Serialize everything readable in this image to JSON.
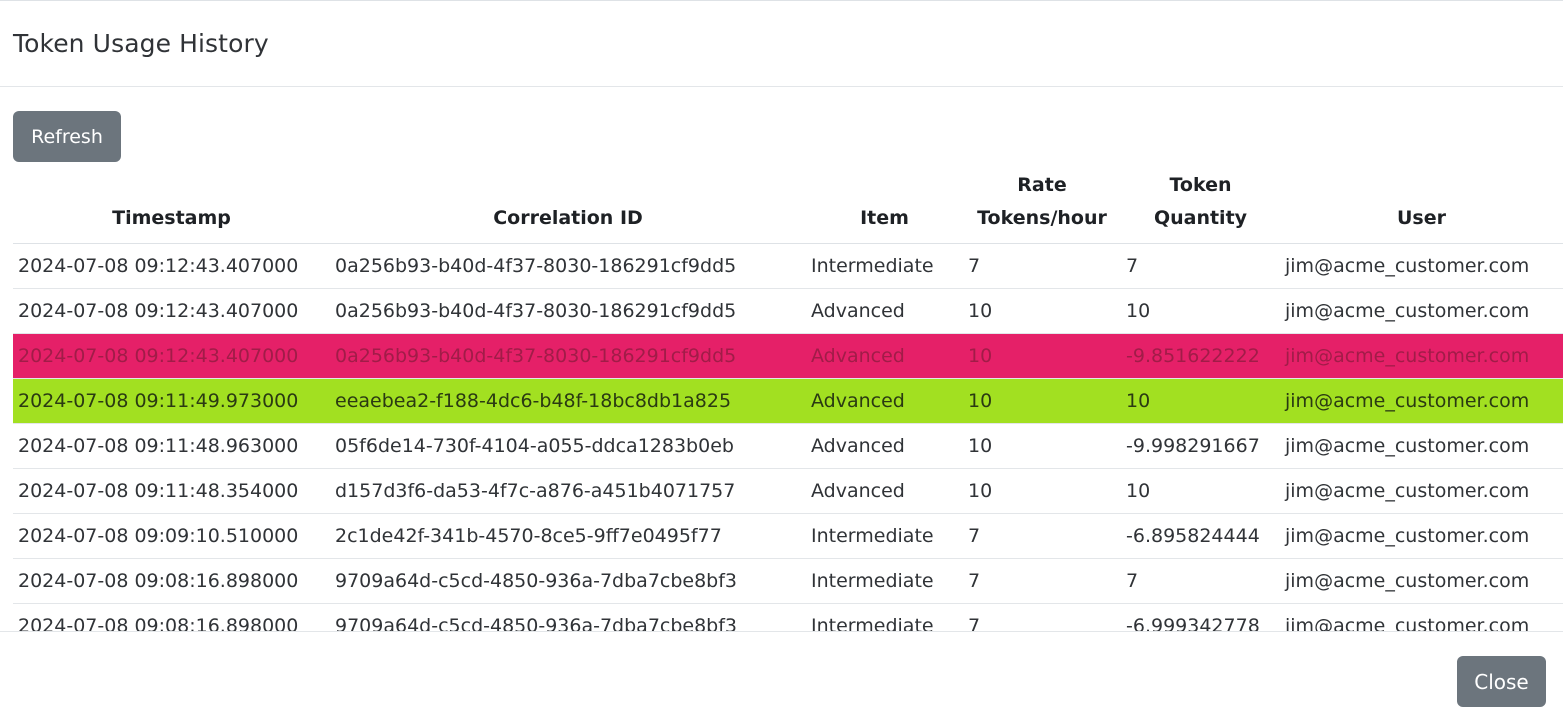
{
  "modal": {
    "title": "Token Usage History",
    "refresh_label": "Refresh",
    "close_label": "Close"
  },
  "table": {
    "headers": {
      "timestamp": "Timestamp",
      "correlation_id": "Correlation ID",
      "item": "Item",
      "rate_line1": "Rate",
      "rate_line2": "Tokens/hour",
      "qty_line1": "Token",
      "qty_line2": "Quantity",
      "user": "User"
    },
    "rows": [
      {
        "timestamp": "2024-07-08 09:12:43.407000",
        "correlation_id": "0a256b93-b40d-4f37-8030-186291cf9dd5",
        "item": "Intermediate",
        "rate": "7",
        "quantity": "7",
        "user": "jim@acme_customer.com",
        "status": "normal"
      },
      {
        "timestamp": "2024-07-08 09:12:43.407000",
        "correlation_id": "0a256b93-b40d-4f37-8030-186291cf9dd5",
        "item": "Advanced",
        "rate": "10",
        "quantity": "10",
        "user": "jim@acme_customer.com",
        "status": "normal"
      },
      {
        "timestamp": "2024-07-08 09:12:43.407000",
        "correlation_id": "0a256b93-b40d-4f37-8030-186291cf9dd5",
        "item": "Advanced",
        "rate": "10",
        "quantity": "-9.851622222",
        "user": "jim@acme_customer.com",
        "status": "danger"
      },
      {
        "timestamp": "2024-07-08 09:11:49.973000",
        "correlation_id": "eeaebea2-f188-4dc6-b48f-18bc8db1a825",
        "item": "Advanced",
        "rate": "10",
        "quantity": "10",
        "user": "jim@acme_customer.com",
        "status": "success"
      },
      {
        "timestamp": "2024-07-08 09:11:48.963000",
        "correlation_id": "05f6de14-730f-4104-a055-ddca1283b0eb",
        "item": "Advanced",
        "rate": "10",
        "quantity": "-9.998291667",
        "user": "jim@acme_customer.com",
        "status": "normal"
      },
      {
        "timestamp": "2024-07-08 09:11:48.354000",
        "correlation_id": "d157d3f6-da53-4f7c-a876-a451b4071757",
        "item": "Advanced",
        "rate": "10",
        "quantity": "10",
        "user": "jim@acme_customer.com",
        "status": "normal"
      },
      {
        "timestamp": "2024-07-08 09:09:10.510000",
        "correlation_id": "2c1de42f-341b-4570-8ce5-9ff7e0495f77",
        "item": "Intermediate",
        "rate": "7",
        "quantity": "-6.895824444",
        "user": "jim@acme_customer.com",
        "status": "normal"
      },
      {
        "timestamp": "2024-07-08 09:08:16.898000",
        "correlation_id": "9709a64d-c5cd-4850-936a-7dba7cbe8bf3",
        "item": "Intermediate",
        "rate": "7",
        "quantity": "7",
        "user": "jim@acme_customer.com",
        "status": "normal"
      },
      {
        "timestamp": "2024-07-08 09:08:16.898000",
        "correlation_id": "9709a64d-c5cd-4850-936a-7dba7cbe8bf3",
        "item": "Intermediate",
        "rate": "7",
        "quantity": "-6.999342778",
        "user": "jim@acme_customer.com",
        "status": "normal"
      }
    ]
  },
  "colors": {
    "button_bg": "#6c757d",
    "danger_row": "#e52068",
    "success_row": "#a2e021"
  }
}
